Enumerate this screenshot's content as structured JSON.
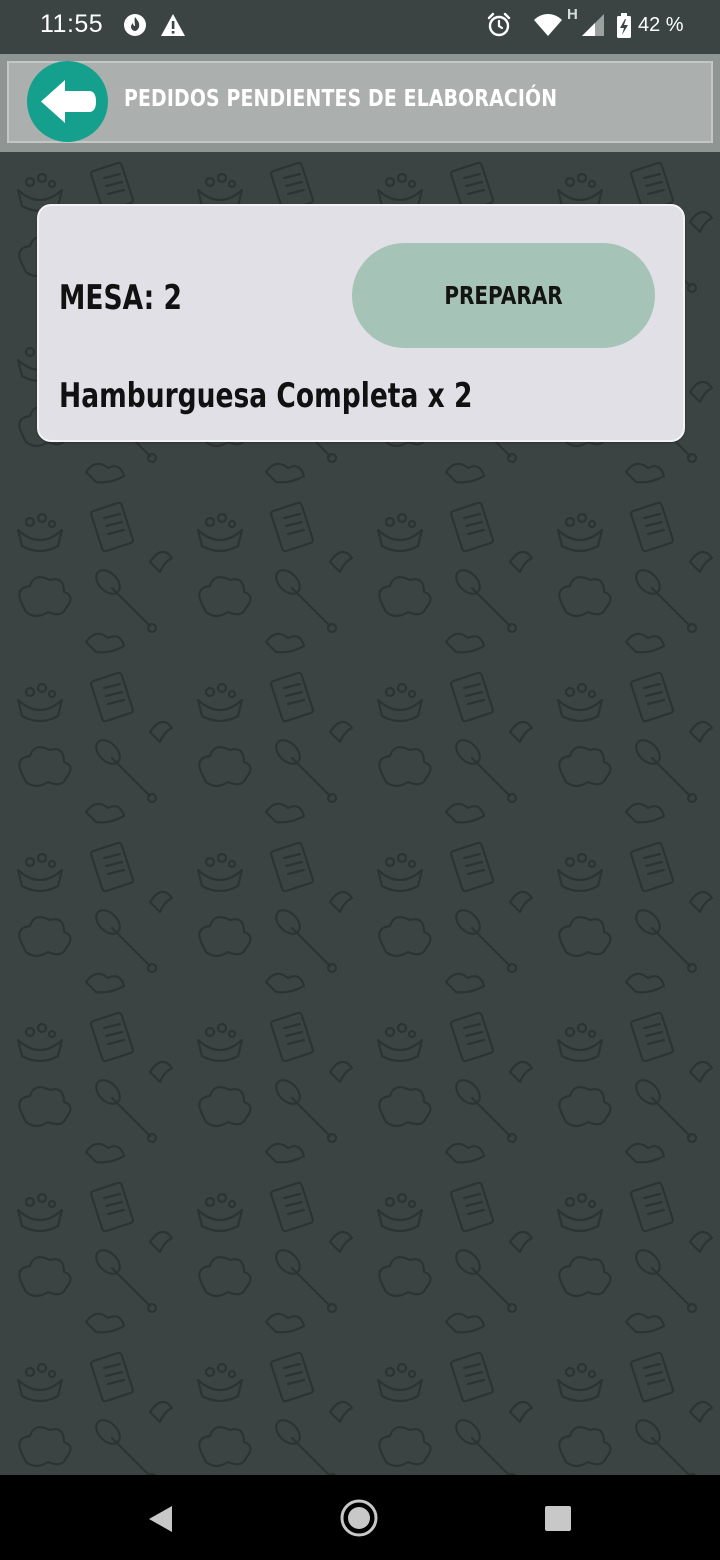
{
  "status_bar": {
    "time": "11:55",
    "battery_percent": "42 %",
    "network_type": "H",
    "icons": [
      "flame-icon",
      "warning-icon",
      "alarm-icon",
      "wifi-icon",
      "signal-icon",
      "battery-charging-icon"
    ]
  },
  "header": {
    "back_icon": "arrow-left-icon",
    "title": "PEDIDOS PENDIENTES DE ELABORACIÓN"
  },
  "order": {
    "table_label": "MESA: 2",
    "action_label": "PREPARAR",
    "item": "Hamburguesa Completa x 2"
  },
  "nav_bar": {
    "icons": [
      "back-triangle-icon",
      "home-circle-icon",
      "recents-square-icon"
    ]
  },
  "colors": {
    "background": "#3c4443",
    "header": "#abb0ae",
    "accent": "#14a08d",
    "card": "#e1e0e6",
    "button": "#a5c3b6"
  }
}
